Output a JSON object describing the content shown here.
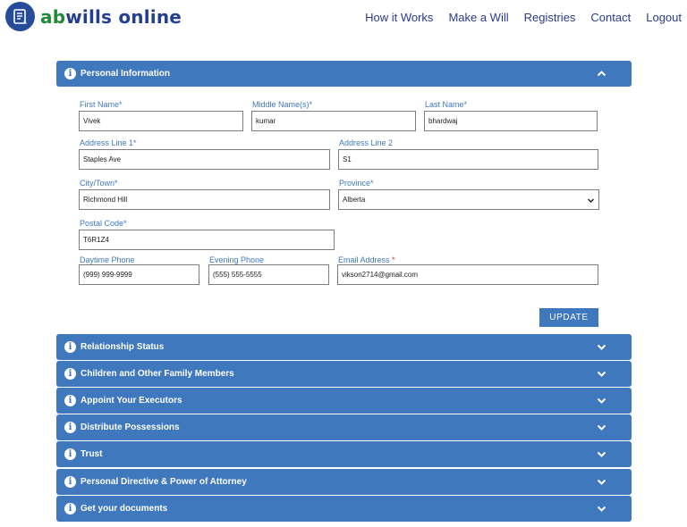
{
  "header": {
    "logo_brand_part1": "ab",
    "logo_brand_part2": "wills online",
    "logo_icon": "document-scroll-icon",
    "nav": [
      "How it Works",
      "Make a Will",
      "Registries",
      "Contact",
      "Logout"
    ]
  },
  "sections": [
    {
      "label": "Personal Information",
      "expanded": true,
      "icon": "info-icon"
    },
    {
      "label": "Relationship Status",
      "expanded": false,
      "icon": "info-icon"
    },
    {
      "label": "Children and Other Family Members",
      "expanded": false,
      "icon": "info-icon"
    },
    {
      "label": "Appoint Your Executors",
      "expanded": false,
      "icon": "info-icon"
    },
    {
      "label": "Distribute Possessions",
      "expanded": false,
      "icon": "info-icon"
    },
    {
      "label": "Trust",
      "expanded": false,
      "icon": "info-icon"
    },
    {
      "label": "Personal Directive & Power of Attorney",
      "expanded": false,
      "icon": "info-icon"
    },
    {
      "label": "Get your documents",
      "expanded": false,
      "icon": "info-icon"
    }
  ],
  "form": {
    "first_name": {
      "label": "First Name*",
      "value": "Vivek"
    },
    "middle_name": {
      "label": "Middle Name(s)*",
      "value": "kumar"
    },
    "last_name": {
      "label": "Last Name*",
      "value": "bhardwaj"
    },
    "address1": {
      "label": "Address Line 1*",
      "value": "Staples Ave"
    },
    "address2": {
      "label": "Address Line 2",
      "value": "S1"
    },
    "city": {
      "label": "City/Town*",
      "value": "Richmond Hill"
    },
    "province": {
      "label": "Province*",
      "value": "Alberta"
    },
    "postal": {
      "label": "Postal Code*",
      "value": "T6R1Z4"
    },
    "daytime_phone": {
      "label": "Daytime Phone",
      "value": "(999) 999-9999"
    },
    "evening_phone": {
      "label": "Evening Phone",
      "value": "(555) 555-5555"
    },
    "email": {
      "label": "Email Address ",
      "required_mark": "*",
      "value": "vikson2714@gmail.com"
    },
    "update_label": "UPDATE"
  },
  "colors": {
    "accent": "#3f78bd",
    "logo_green": "#1f8a3a",
    "logo_blue": "#243f8f",
    "nav": "#2c3a8a"
  }
}
